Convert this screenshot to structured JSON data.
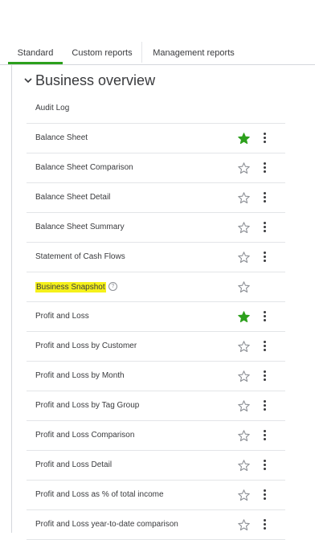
{
  "tabs": [
    {
      "label": "Standard",
      "active": true
    },
    {
      "label": "Custom reports",
      "active": false
    },
    {
      "label": "Management reports",
      "active": false
    }
  ],
  "section": {
    "title": "Business overview",
    "expanded": true
  },
  "colors": {
    "accent": "#2ca01c",
    "highlight": "#f5f11a",
    "star_empty": "#8d9096"
  },
  "reports": [
    {
      "label": "Audit Log",
      "favorite": null,
      "menu": false
    },
    {
      "label": "Balance Sheet",
      "favorite": true,
      "menu": true
    },
    {
      "label": "Balance Sheet Comparison",
      "favorite": false,
      "menu": true
    },
    {
      "label": "Balance Sheet Detail",
      "favorite": false,
      "menu": true
    },
    {
      "label": "Balance Sheet Summary",
      "favorite": false,
      "menu": true
    },
    {
      "label": "Statement of Cash Flows",
      "favorite": false,
      "menu": true
    },
    {
      "label": "Business Snapshot",
      "favorite": false,
      "menu": false,
      "highlighted": true,
      "help_icon": true
    },
    {
      "label": "Profit and Loss",
      "favorite": true,
      "menu": true
    },
    {
      "label": "Profit and Loss by Customer",
      "favorite": false,
      "menu": true
    },
    {
      "label": "Profit and Loss by Month",
      "favorite": false,
      "menu": true
    },
    {
      "label": "Profit and Loss by Tag Group",
      "favorite": false,
      "menu": true
    },
    {
      "label": "Profit and Loss Comparison",
      "favorite": false,
      "menu": true
    },
    {
      "label": "Profit and Loss Detail",
      "favorite": false,
      "menu": true
    },
    {
      "label": "Profit and Loss as % of total income",
      "favorite": false,
      "menu": true
    },
    {
      "label": "Profit and Loss year-to-date comparison",
      "favorite": false,
      "menu": true
    }
  ]
}
